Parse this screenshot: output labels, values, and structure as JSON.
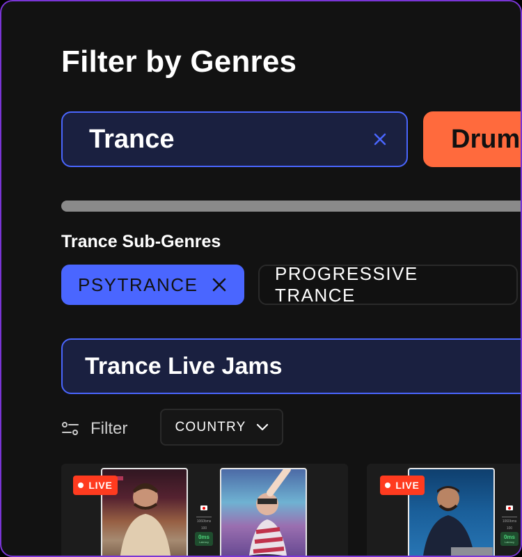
{
  "page": {
    "title": "Filter by Genres"
  },
  "genres": [
    {
      "label": "Trance",
      "selected": true,
      "clear_icon": "close-icon"
    },
    {
      "label": "Drum",
      "selected": false
    }
  ],
  "sub_genres": {
    "heading": "Trance Sub-Genres",
    "items": [
      {
        "label": "PSYTRANCE",
        "selected": true,
        "clear_icon": "close-icon"
      },
      {
        "label": "PROGRESSIVE TRANCE",
        "selected": false
      }
    ]
  },
  "section": {
    "title": "Trance Live Jams"
  },
  "filters": {
    "filter_label": "Filter",
    "filter_icon": "sliders-icon",
    "country_label": "COUNTRY",
    "country_icon": "chevron-down-icon"
  },
  "cards": [
    {
      "badge": "LIVE",
      "mini_stats": {
        "bpm": "1060bms",
        "value": "100",
        "latency": "0ms",
        "latency_label": "Latency"
      }
    },
    {
      "badge": "LIVE",
      "mini_stats": {
        "bpm": "1060bms",
        "value": "100",
        "latency": "0ms",
        "latency_label": "Latency"
      }
    }
  ],
  "colors": {
    "accent_blue": "#4a66ff",
    "accent_orange": "#ff6a3d",
    "live_red": "#ff3b1f",
    "frame_purple": "#7a35d6"
  }
}
